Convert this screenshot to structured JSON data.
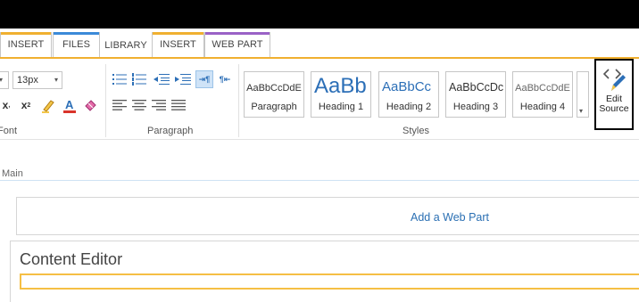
{
  "tabs": [
    {
      "label": "INSERT"
    },
    {
      "label": "FILES"
    },
    {
      "label": "LIBRARY"
    },
    {
      "label": "INSERT"
    },
    {
      "label": "WEB PART"
    }
  ],
  "colors": {
    "insert_tab": "#f0b030",
    "files_tab": "#3b8ad8",
    "webpart_tab": "#9a62c6",
    "ribbon_accent": "#f0b030",
    "link_blue": "#2a6fb3"
  },
  "ribbon": {
    "font": {
      "size_value": "13px",
      "group_label": "Font",
      "icons": [
        "subscript-icon",
        "superscript-icon",
        "highlight-icon",
        "font-color-icon",
        "clear-format-icon"
      ]
    },
    "paragraph": {
      "group_label": "Paragraph",
      "icons": [
        "bullets-icon",
        "numbering-icon",
        "decrease-indent-icon",
        "increase-indent-icon",
        "ltr-icon",
        "rtl-icon",
        "align-left-icon",
        "align-center-icon",
        "align-right-icon",
        "justify-icon"
      ]
    },
    "styles": {
      "group_label": "Styles",
      "items": [
        {
          "sample": "AaBbCcDdE",
          "name": "Paragraph"
        },
        {
          "sample": "AaBb",
          "name": "Heading 1"
        },
        {
          "sample": "AaBbCc",
          "name": "Heading 2"
        },
        {
          "sample": "AaBbCcDc",
          "name": "Heading 3"
        },
        {
          "sample": "AaBbCcDdE",
          "name": "Heading 4"
        }
      ]
    },
    "edit_source": {
      "line1": "Edit",
      "line2": "Source"
    }
  },
  "page": {
    "zone_label": "Main",
    "add_web_part": "Add a Web Part",
    "content_editor_title": "Content Editor"
  }
}
